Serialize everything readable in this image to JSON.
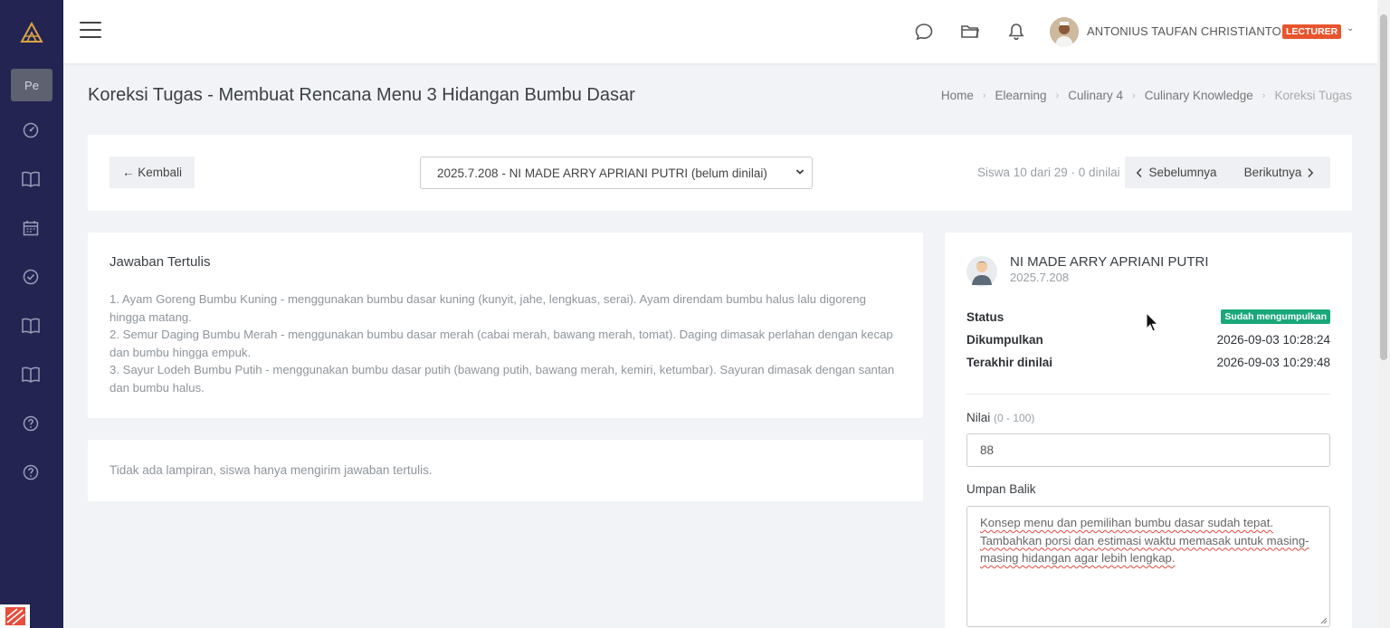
{
  "sidebar": {
    "pe_label": "Pe",
    "items": [
      {
        "icon": "dashboard-icon"
      },
      {
        "icon": "book-icon"
      },
      {
        "icon": "calendar-icon"
      },
      {
        "icon": "check-circle-icon"
      },
      {
        "icon": "book-icon"
      },
      {
        "icon": "book-icon"
      },
      {
        "icon": "help-icon"
      },
      {
        "icon": "help-icon"
      }
    ]
  },
  "header": {
    "user_name": "ANTONIUS TAUFAN CHRISTIANTO",
    "role_badge": "LECTURER",
    "role_color": "#e8542d"
  },
  "page": {
    "title": "Koreksi Tugas - Membuat Rencana Menu 3 Hidangan Bumbu Dasar",
    "breadcrumb": [
      "Home",
      "Elearning",
      "Culinary 4",
      "Culinary Knowledge",
      "Koreksi Tugas"
    ]
  },
  "nav": {
    "back_label": "← Kembali",
    "selected_student": "2025.7.208 - NI MADE ARRY APRIANI PUTRI (belum dinilai)",
    "student_info": "Siswa 10 dari 29 · 0 dinilai",
    "prev_label": "Sebelumnya",
    "next_label": "Berikutnya"
  },
  "answer": {
    "title": "Jawaban Tertulis",
    "lines": [
      "1. Ayam Goreng Bumbu Kuning - menggunakan bumbu dasar kuning (kunyit, jahe, lengkuas, serai). Ayam direndam bumbu halus lalu digoreng hingga matang.",
      "2. Semur Daging Bumbu Merah - menggunakan bumbu dasar merah (cabai merah, bawang merah, tomat). Daging dimasak perlahan dengan kecap dan bumbu hingga empuk.",
      "3. Sayur Lodeh Bumbu Putih - menggunakan bumbu dasar putih (bawang putih, bawang merah, kemiri, ketumbar). Sayuran dimasak dengan santan dan bumbu halus."
    ],
    "attachment_text": "Tidak ada lampiran, siswa hanya mengirim jawaban tertulis."
  },
  "grading": {
    "student_name": "NI MADE ARRY APRIANI PUTRI",
    "student_id": "2025.7.208",
    "status_label": "Status",
    "status_badge": "Sudah mengumpulkan",
    "status_color": "#1aa77a",
    "submitted_label": "Dikumpulkan",
    "submitted_value": "2026-09-03 10:28:24",
    "graded_label": "Terakhir dinilai",
    "graded_value": "2026-09-03 10:29:48",
    "score_label": "Nilai",
    "score_hint": "(0 - 100)",
    "score_value": "88",
    "feedback_label": "Umpan Balik",
    "feedback_value": "Konsep menu dan pemilihan bumbu dasar sudah tepat. Tambahkan porsi dan estimasi waktu memasak untuk masing-masing hidangan agar lebih lengkap."
  }
}
